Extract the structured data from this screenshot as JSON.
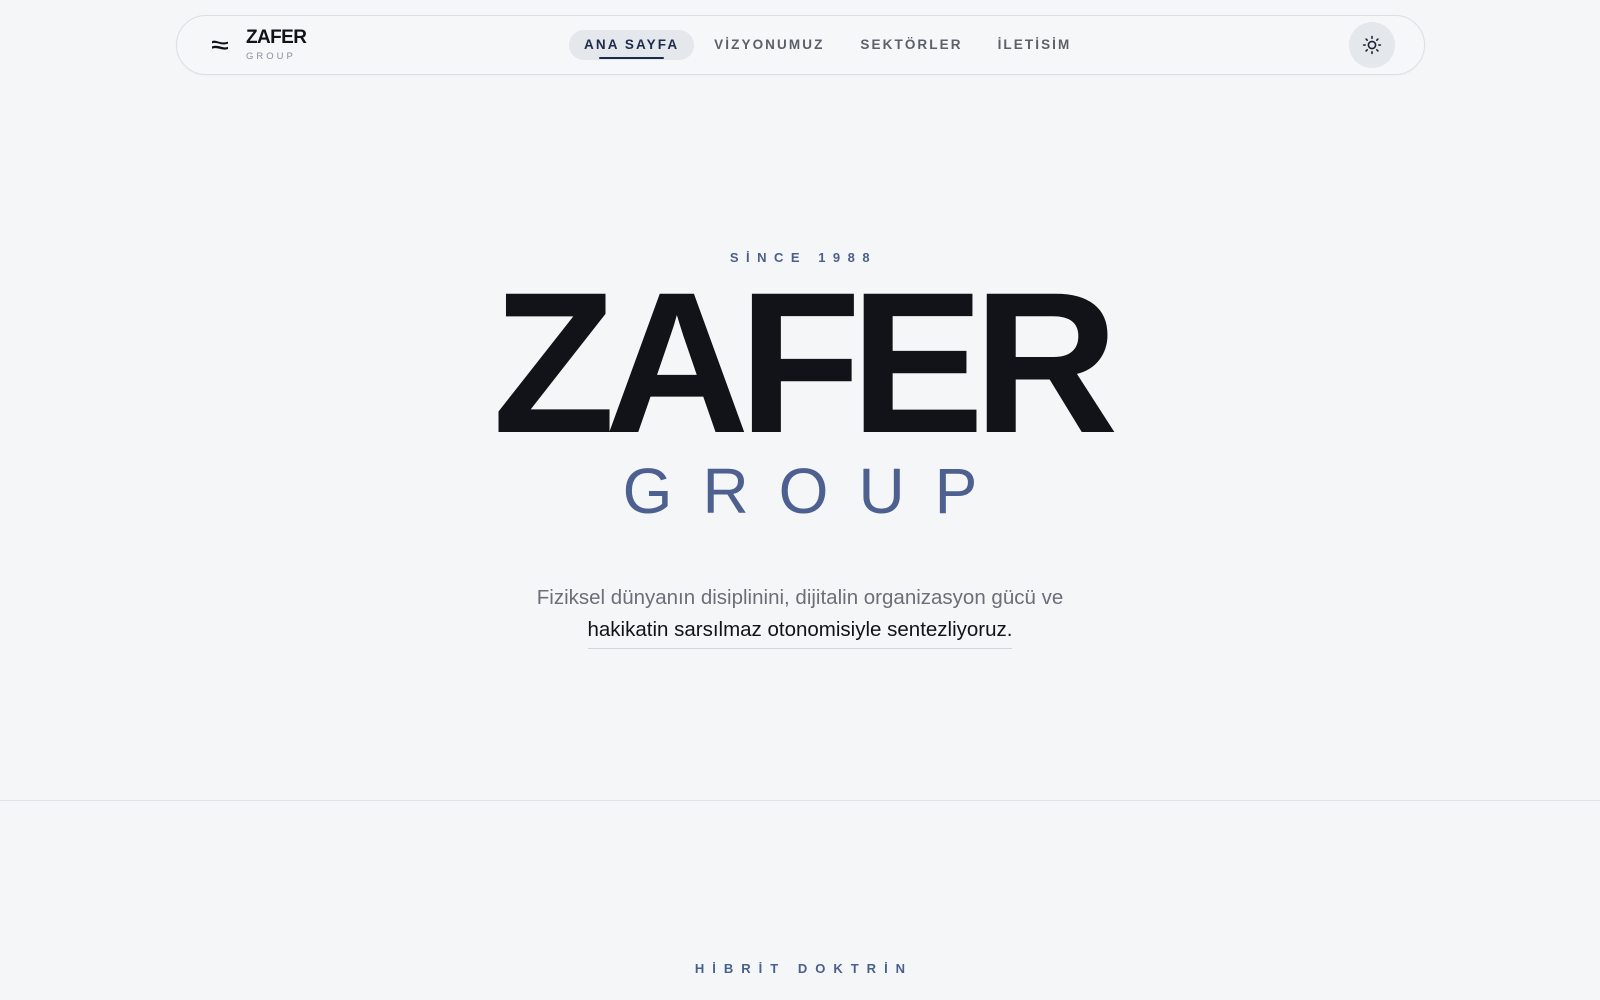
{
  "header": {
    "brand_name": "ZAFER",
    "brand_sub": "GROUP",
    "brand_icon": "brand-mark-icon",
    "nav": [
      {
        "label": "ANA SAYFA",
        "active": true
      },
      {
        "label": "VİZYONUMUZ",
        "active": false
      },
      {
        "label": "SEKTÖRLER",
        "active": false
      },
      {
        "label": "İLETİSİM",
        "active": false
      }
    ],
    "theme_toggle_icon": "sun-icon"
  },
  "hero": {
    "eyebrow": "SİNCE 1988",
    "title": "ZAFER",
    "subtitle": "GROUP",
    "description_line1": "Fiziksel dünyanın disiplinini, dijitalin organizasyon gücü ve",
    "description_line2": "hakikatin sarsılmaz otonomisiyle sentezliyoruz."
  },
  "section": {
    "eyebrow": "HİBRİT DOKTRİN"
  },
  "colors": {
    "background": "#f4f6f8",
    "text_primary": "#111318",
    "accent": "#4d608f",
    "nav_active": "#1d2b4a"
  }
}
